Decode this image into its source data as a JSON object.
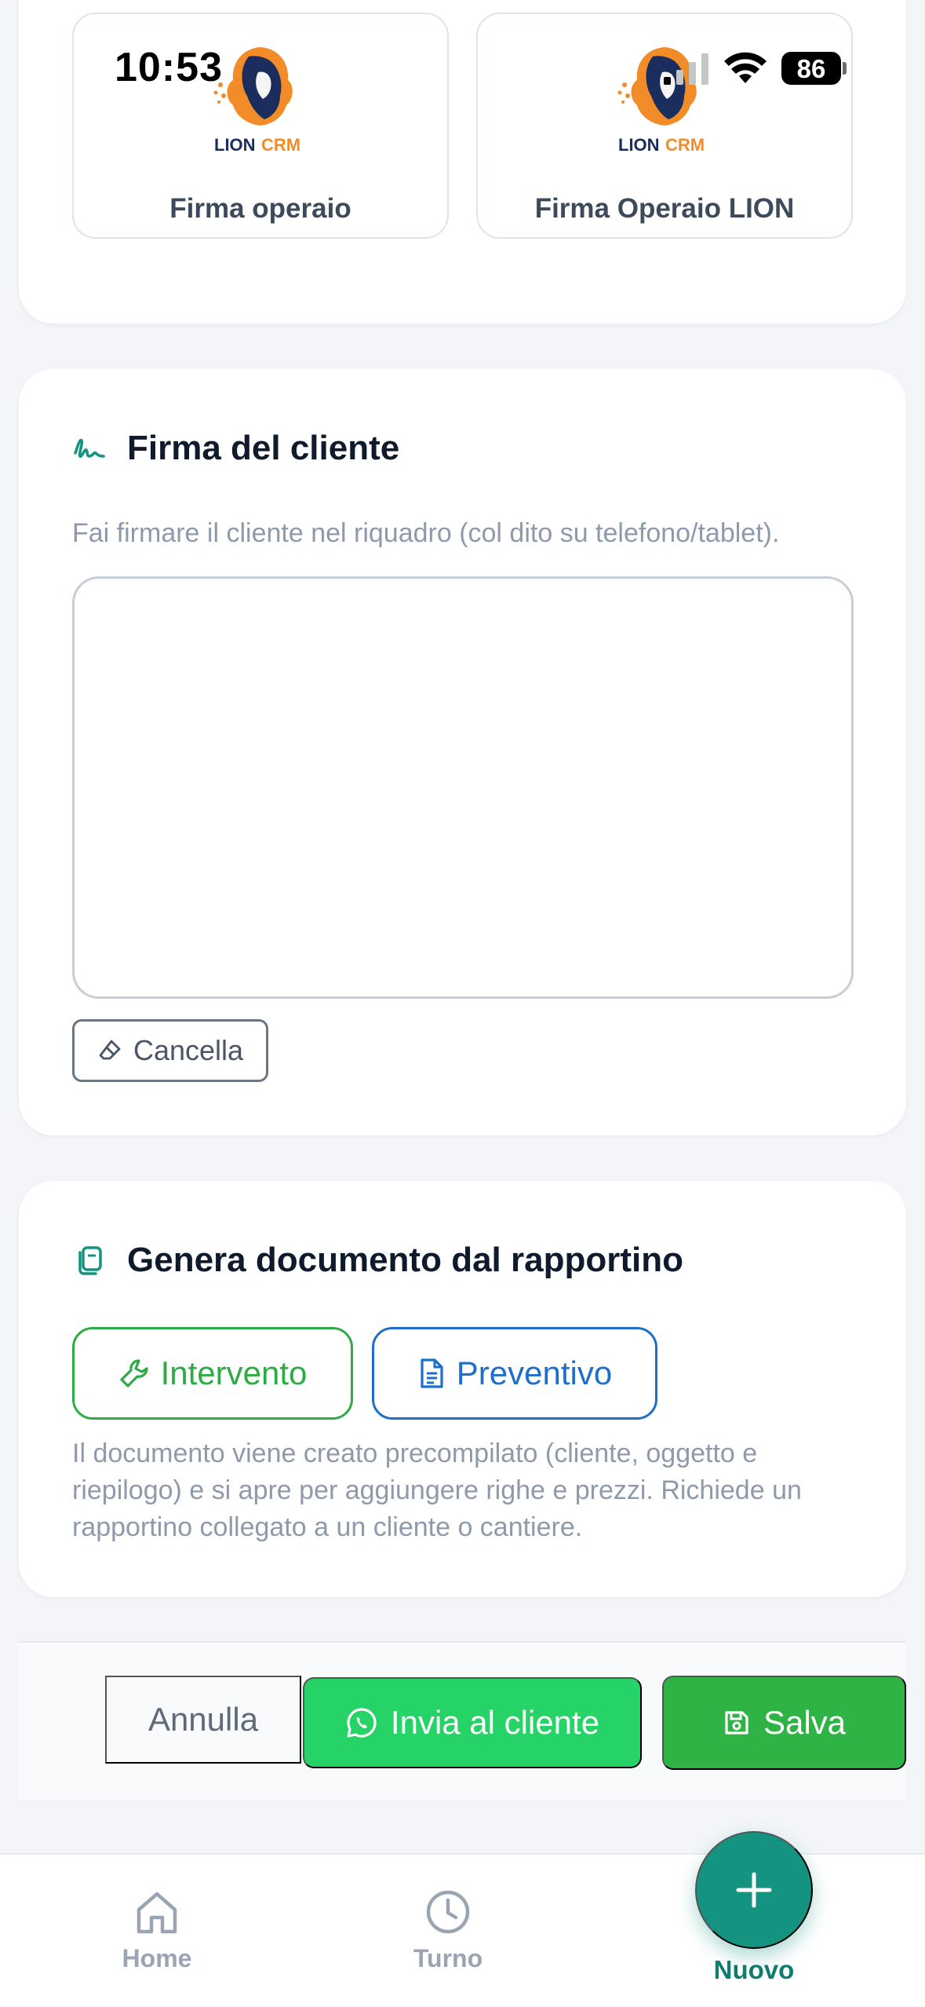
{
  "status_bar": {
    "time": "10:53",
    "battery": "86"
  },
  "signature_tiles": [
    {
      "logo_text_main": "LION",
      "logo_text_accent": "CRM",
      "label": "Firma operaio"
    },
    {
      "logo_text_main": "LION",
      "logo_text_accent": "CRM",
      "label": "Firma Operaio LION"
    }
  ],
  "customer_signature": {
    "title": "Firma del cliente",
    "hint": "Fai firmare il cliente nel riquadro (col dito su telefono/tablet).",
    "clear_label": "Cancella"
  },
  "generate_document": {
    "title": "Genera documento dal rapportino",
    "buttons": {
      "intervento": "Intervento",
      "preventivo": "Preventivo"
    },
    "note": "Il documento viene creato precompilato (cliente, oggetto e riepilogo) e si apre per aggiungere righe e prezzi. Richiede un rapportino collegato a un cliente o cantiere."
  },
  "actions": {
    "cancel": "Annulla",
    "send": "Invia al cliente",
    "save": "Salva"
  },
  "bottom_nav": {
    "home": "Home",
    "turno": "Turno",
    "nuovo": "Nuovo"
  },
  "colors": {
    "accent_teal": "#149381",
    "success_green": "#2fb344",
    "whatsapp_green": "#25d366",
    "link_blue": "#1d6fc9",
    "logo_navy": "#1b2d5c",
    "logo_orange": "#f28c28"
  },
  "icons": {
    "signature": "signature-icon",
    "documents": "documents-icon",
    "wrench": "wrench-icon",
    "document": "document-icon",
    "eraser": "eraser-icon",
    "whatsapp": "whatsapp-icon",
    "save": "save-icon",
    "home": "home-icon",
    "clock": "clock-icon",
    "plus": "plus-icon"
  }
}
